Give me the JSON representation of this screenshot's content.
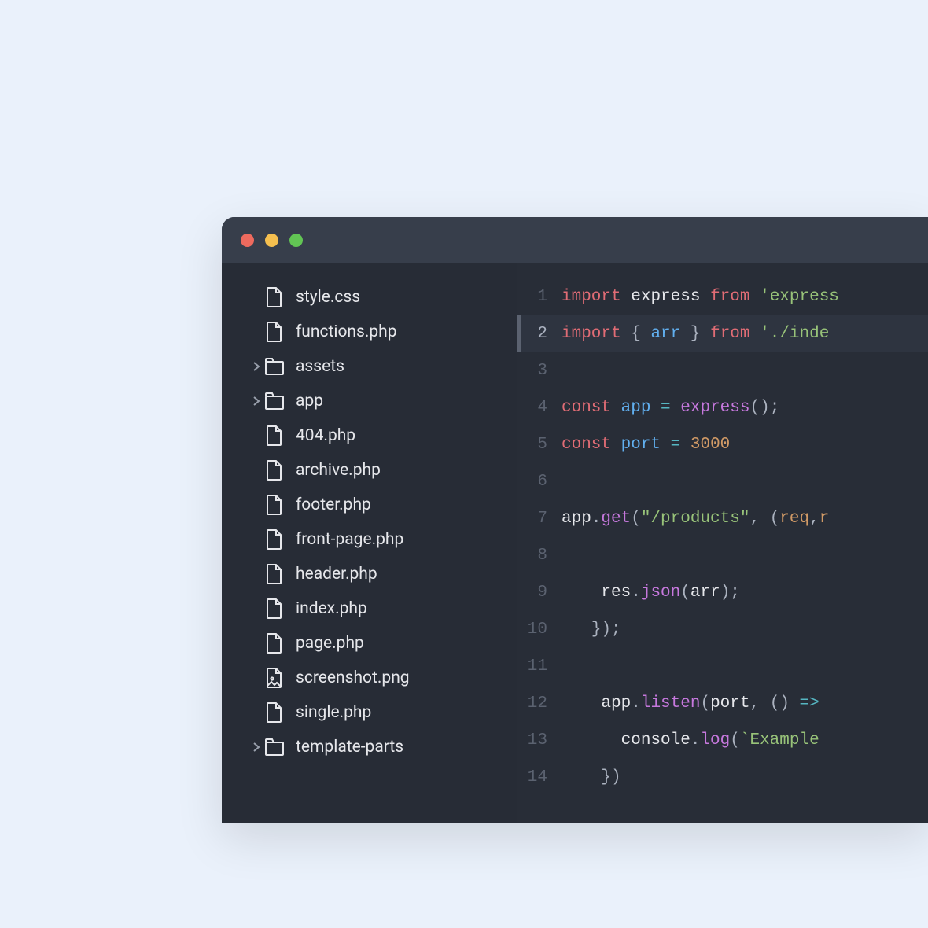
{
  "sidebar": {
    "items": [
      {
        "name": "style.css",
        "type": "file",
        "expandable": false
      },
      {
        "name": "functions.php",
        "type": "file",
        "expandable": false
      },
      {
        "name": "assets",
        "type": "folder",
        "expandable": true
      },
      {
        "name": "app",
        "type": "folder",
        "expandable": true
      },
      {
        "name": "404.php",
        "type": "file",
        "expandable": false
      },
      {
        "name": "archive.php",
        "type": "file",
        "expandable": false
      },
      {
        "name": "footer.php",
        "type": "file",
        "expandable": false
      },
      {
        "name": "front-page.php",
        "type": "file",
        "expandable": false
      },
      {
        "name": "header.php",
        "type": "file",
        "expandable": false
      },
      {
        "name": "index.php",
        "type": "file",
        "expandable": false
      },
      {
        "name": "page.php",
        "type": "file",
        "expandable": false
      },
      {
        "name": "screenshot.png",
        "type": "image",
        "expandable": false
      },
      {
        "name": "single.php",
        "type": "file",
        "expandable": false
      },
      {
        "name": "template-parts",
        "type": "folder",
        "expandable": true
      }
    ]
  },
  "editor": {
    "highlighted_line": 2,
    "lines": {
      "1": {
        "n": "1"
      },
      "2": {
        "n": "2"
      },
      "3": {
        "n": "3"
      },
      "4": {
        "n": "4"
      },
      "5": {
        "n": "5"
      },
      "6": {
        "n": "6"
      },
      "7": {
        "n": "7"
      },
      "8": {
        "n": "8"
      },
      "9": {
        "n": "9"
      },
      "10": {
        "n": "10"
      },
      "11": {
        "n": "11"
      },
      "12": {
        "n": "12"
      },
      "13": {
        "n": "13"
      },
      "14": {
        "n": "14"
      }
    },
    "tokens": {
      "import": "import",
      "from": "from",
      "const": "const",
      "express_id": "express",
      "arr": "arr",
      "app": "app",
      "port": "port",
      "port_val": "3000",
      "express_lit": "'express",
      "index_lit": "'./inde",
      "products_lit": "\"/products\"",
      "get": "get",
      "json": "json",
      "listen": "listen",
      "log": "log",
      "console": "console",
      "res": "res",
      "req": "req",
      "r_frag": "r",
      "example_lit": "`Example",
      "eq": "=",
      "arrow": "=>",
      "lbrace": "{",
      "rbrace": "}",
      "lparen": "(",
      "rparen": ")",
      "semi": ";",
      "comma": ",",
      "dot": ".",
      "space": " ",
      "rbrace_paren_semi": "});",
      "rbrace_paren": "})",
      "empty_parens": "()",
      "paren_semi": "();"
    }
  },
  "colors": {
    "bg_page": "#eaf1fb",
    "bg_window": "#272c36",
    "bg_titlebar": "#373e4b",
    "traffic_close": "#ed6a5e",
    "traffic_min": "#f5bf4f",
    "traffic_max": "#62c554"
  }
}
